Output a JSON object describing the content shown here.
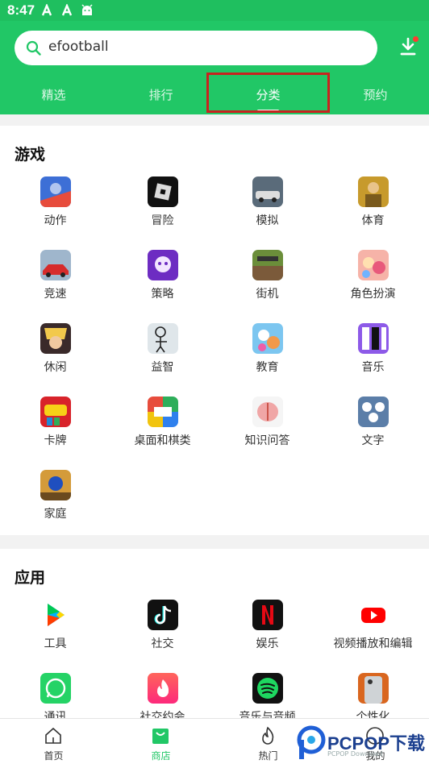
{
  "status": {
    "time": "8:47"
  },
  "search": {
    "query": "efootball"
  },
  "tabs": [
    {
      "label": "精选"
    },
    {
      "label": "排行"
    },
    {
      "label": "分类"
    },
    {
      "label": "预约"
    }
  ],
  "active_tab_index": 2,
  "games": {
    "title": "游戏",
    "items": [
      {
        "label": "动作"
      },
      {
        "label": "冒险"
      },
      {
        "label": "模拟"
      },
      {
        "label": "体育"
      },
      {
        "label": "竞速"
      },
      {
        "label": "策略"
      },
      {
        "label": "街机"
      },
      {
        "label": "角色扮演"
      },
      {
        "label": "休闲"
      },
      {
        "label": "益智"
      },
      {
        "label": "教育"
      },
      {
        "label": "音乐"
      },
      {
        "label": "卡牌"
      },
      {
        "label": "桌面和棋类"
      },
      {
        "label": "知识问答"
      },
      {
        "label": "文字"
      },
      {
        "label": "家庭"
      }
    ]
  },
  "apps": {
    "title": "应用",
    "items": [
      {
        "label": "工具"
      },
      {
        "label": "社交"
      },
      {
        "label": "娱乐"
      },
      {
        "label": "视频播放和编辑"
      },
      {
        "label": "通讯"
      },
      {
        "label": "社交约会"
      },
      {
        "label": "音乐与音频"
      },
      {
        "label": "个性化"
      }
    ]
  },
  "bottom_nav": [
    {
      "label": "首页"
    },
    {
      "label": "商店"
    },
    {
      "label": "热门"
    },
    {
      "label": "我的"
    }
  ],
  "watermark": {
    "brand": "PCPOP下载",
    "sub": "PCPOP Download"
  },
  "colors": {
    "brand_green": "#21c766",
    "highlight_red": "#c8231f"
  }
}
